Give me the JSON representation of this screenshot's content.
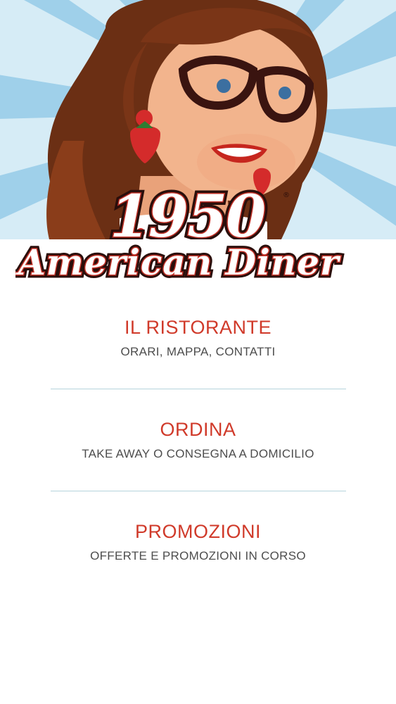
{
  "brand": {
    "year": "1950",
    "name": "American Diner",
    "registered_mark": "®"
  },
  "menu": [
    {
      "title": "IL RISTORANTE",
      "subtitle": "ORARI, MAPPA, CONTATTI"
    },
    {
      "title": "ORDINA",
      "subtitle": "TAKE AWAY O CONSEGNA A DOMICILIO"
    },
    {
      "title": "PROMOZIONI",
      "subtitle": "OFFERTE E PROMOZIONI IN CORSO"
    }
  ],
  "colors": {
    "accent_red": "#d03a2a",
    "subtitle_gray": "#4d4d4d",
    "divider": "#b6d3dc",
    "ray_blue": "#9fd0ea"
  }
}
